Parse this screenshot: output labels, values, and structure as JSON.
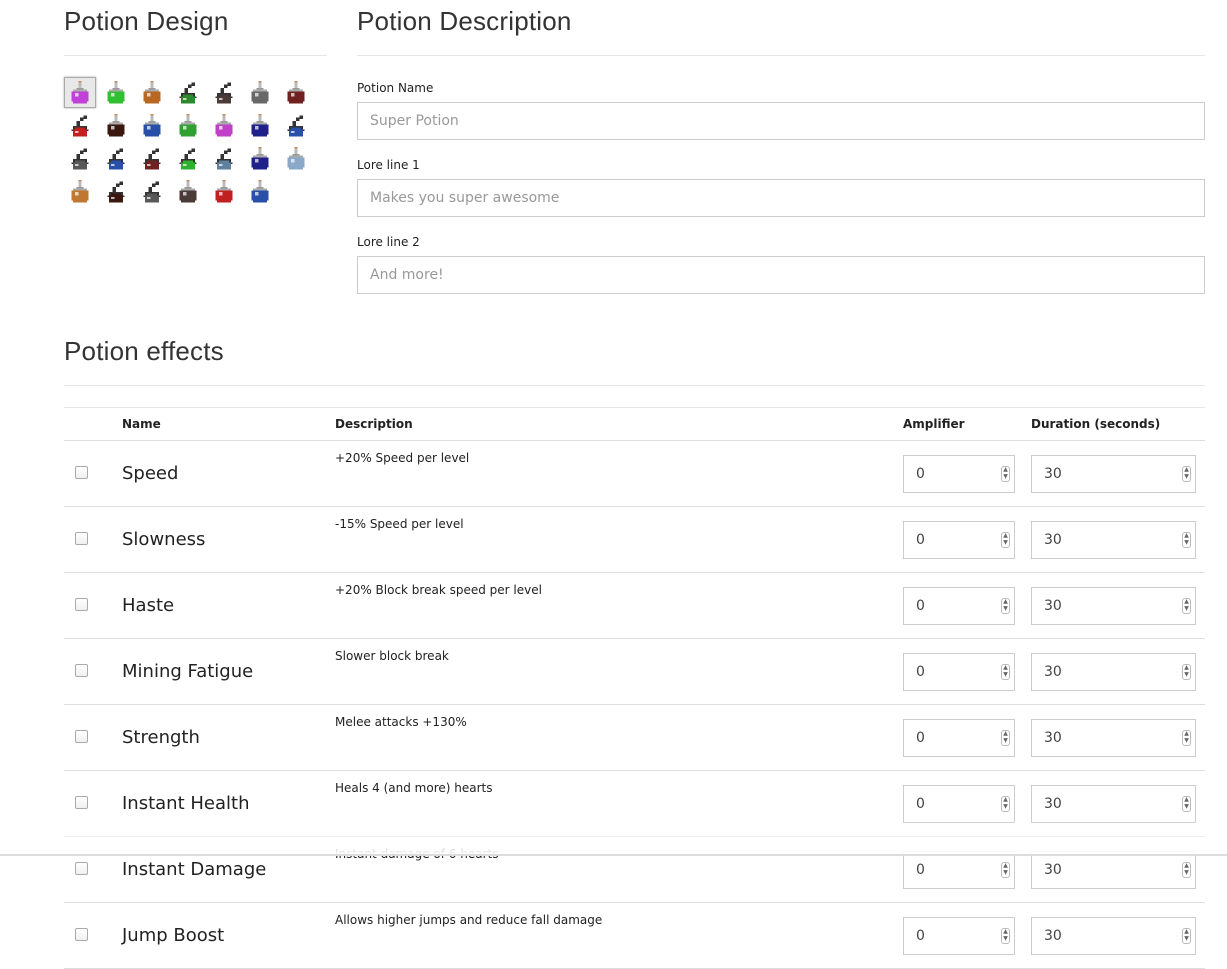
{
  "design": {
    "title": "Potion Design",
    "potions": [
      {
        "color": "#c040d8",
        "icon": "potion-icon",
        "style": "bottle"
      },
      {
        "color": "#30c030",
        "icon": "potion-icon",
        "style": "bottle"
      },
      {
        "color": "#b86820",
        "icon": "potion-icon",
        "style": "bottle"
      },
      {
        "color": "#2c8a2c",
        "icon": "splash-potion-icon",
        "style": "splash"
      },
      {
        "color": "#4a3a38",
        "icon": "splash-potion-icon",
        "style": "splash"
      },
      {
        "color": "#686868",
        "icon": "potion-icon",
        "style": "bottle"
      },
      {
        "color": "#702020",
        "icon": "potion-icon",
        "style": "bottle"
      },
      {
        "color": "#c02020",
        "icon": "splash-potion-icon",
        "style": "splash"
      },
      {
        "color": "#3a1810",
        "icon": "potion-icon",
        "style": "bottle"
      },
      {
        "color": "#2850a8",
        "icon": "potion-icon",
        "style": "bottle"
      },
      {
        "color": "#30a030",
        "icon": "potion-icon",
        "style": "bottle"
      },
      {
        "color": "#c040c8",
        "icon": "potion-icon",
        "style": "bottle"
      },
      {
        "color": "#20208a",
        "icon": "potion-icon",
        "style": "bottle"
      },
      {
        "color": "#2850a8",
        "icon": "splash-potion-icon",
        "style": "splash"
      },
      {
        "color": "#585858",
        "icon": "splash-potion-icon",
        "style": "splash"
      },
      {
        "color": "#2850a8",
        "icon": "splash-potion-icon",
        "style": "splash"
      },
      {
        "color": "#702020",
        "icon": "splash-potion-icon",
        "style": "splash"
      },
      {
        "color": "#30b030",
        "icon": "splash-potion-icon",
        "style": "splash"
      },
      {
        "color": "#6080a0",
        "icon": "splash-potion-icon",
        "style": "splash"
      },
      {
        "color": "#20208a",
        "icon": "potion-icon",
        "style": "bottle"
      },
      {
        "color": "#8aa8c8",
        "icon": "potion-icon",
        "style": "bottle"
      },
      {
        "color": "#c07830",
        "icon": "potion-icon",
        "style": "bottle"
      },
      {
        "color": "#3a1810",
        "icon": "splash-potion-icon",
        "style": "splash"
      },
      {
        "color": "#585858",
        "icon": "splash-potion-icon",
        "style": "splash"
      },
      {
        "color": "#4a3a38",
        "icon": "potion-icon",
        "style": "bottle"
      },
      {
        "color": "#c02020",
        "icon": "potion-icon",
        "style": "bottle"
      },
      {
        "color": "#2850a8",
        "icon": "potion-icon",
        "style": "bottle"
      }
    ],
    "selected_index": 0
  },
  "description": {
    "title": "Potion Description",
    "name_label": "Potion Name",
    "name_placeholder": "Super Potion",
    "lore1_label": "Lore line 1",
    "lore1_placeholder": "Makes you super awesome",
    "lore2_label": "Lore line 2",
    "lore2_placeholder": "And more!"
  },
  "effects": {
    "title": "Potion effects",
    "columns": {
      "name": "Name",
      "description": "Description",
      "amplifier": "Amplifier",
      "duration": "Duration (seconds)"
    },
    "rows": [
      {
        "name": "Speed",
        "description": "+20% Speed per level",
        "amplifier": "0",
        "duration": "30"
      },
      {
        "name": "Slowness",
        "description": "-15% Speed per level",
        "amplifier": "0",
        "duration": "30"
      },
      {
        "name": "Haste",
        "description": "+20% Block break speed per level",
        "amplifier": "0",
        "duration": "30"
      },
      {
        "name": "Mining Fatigue",
        "description": "Slower block break",
        "amplifier": "0",
        "duration": "30"
      },
      {
        "name": "Strength",
        "description": "Melee attacks +130%",
        "amplifier": "0",
        "duration": "30"
      },
      {
        "name": "Instant Health",
        "description": "Heals 4 (and more) hearts",
        "amplifier": "0",
        "duration": "30"
      },
      {
        "name": "Instant Damage",
        "description": "Instant damage of 6 hearts",
        "amplifier": "0",
        "duration": "30"
      },
      {
        "name": "Jump Boost",
        "description": "Allows higher jumps and reduce fall damage",
        "amplifier": "0",
        "duration": "30"
      }
    ]
  }
}
